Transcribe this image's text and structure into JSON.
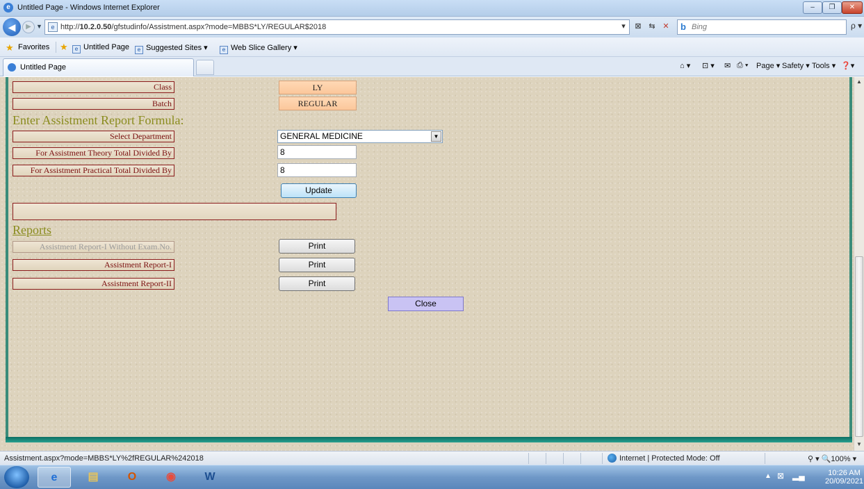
{
  "window": {
    "title": "Untitled Page - Windows Internet Explorer",
    "min": "–",
    "max": "❐",
    "close": "✕"
  },
  "nav": {
    "url_prefix": "http://",
    "url_host": "10.2.0.50",
    "url_path": "/gfstudinfo/Assistment.aspx?mode=MBBS*LY/REGULAR$2018",
    "search_placeholder": "Bing",
    "back": "◀",
    "forward": "▶",
    "history": "▼",
    "addr_tools": [
      "▾",
      "⊠",
      "⇆",
      "✕"
    ],
    "search_go": "ρ ▾"
  },
  "favorites": {
    "label": "Favorites",
    "items": [
      "Untitled Page",
      "Suggested Sites ▾",
      "Web Slice Gallery ▾"
    ]
  },
  "tabs": {
    "active": "Untitled Page"
  },
  "commands": [
    "⌂ ▾",
    "⊡ ▾",
    "✉",
    "⎙ ▾",
    "Page ▾",
    "Safety ▾",
    "Tools ▾",
    "❓▾"
  ],
  "form": {
    "class_label": "Class",
    "class_value": "LY",
    "batch_label": "Batch",
    "batch_value": "REGULAR",
    "formula_heading": "Enter Assistment Report Formula:",
    "dept_label": "Select Department",
    "dept_value": "GENERAL MEDICINE",
    "theory_label": "For Assistment Theory Total Divided By",
    "theory_value": "8",
    "practical_label": "For Assistment Practical Total Divided By",
    "practical_value": "8",
    "update_label": "Update",
    "message": ""
  },
  "reports": {
    "heading": "Reports",
    "items": [
      {
        "label": "Assistment Report-I Without Exam.No.",
        "button": "Print",
        "disabled": true
      },
      {
        "label": "Assistment Report-I",
        "button": "Print",
        "disabled": false
      },
      {
        "label": "Assistment Report-II",
        "button": "Print",
        "disabled": false
      }
    ],
    "close_label": "Close"
  },
  "status": {
    "url": "Assistment.aspx?mode=MBBS*LY%2fREGULAR%242018",
    "zone": "Internet | Protected Mode: Off",
    "zoom": "⚲ ▾   🔍100%  ▾"
  },
  "taskbar": {
    "time": "10:26 AM",
    "date": "20/09/2021",
    "apps": [
      "e",
      "▤",
      "O",
      "◉",
      "W"
    ]
  }
}
